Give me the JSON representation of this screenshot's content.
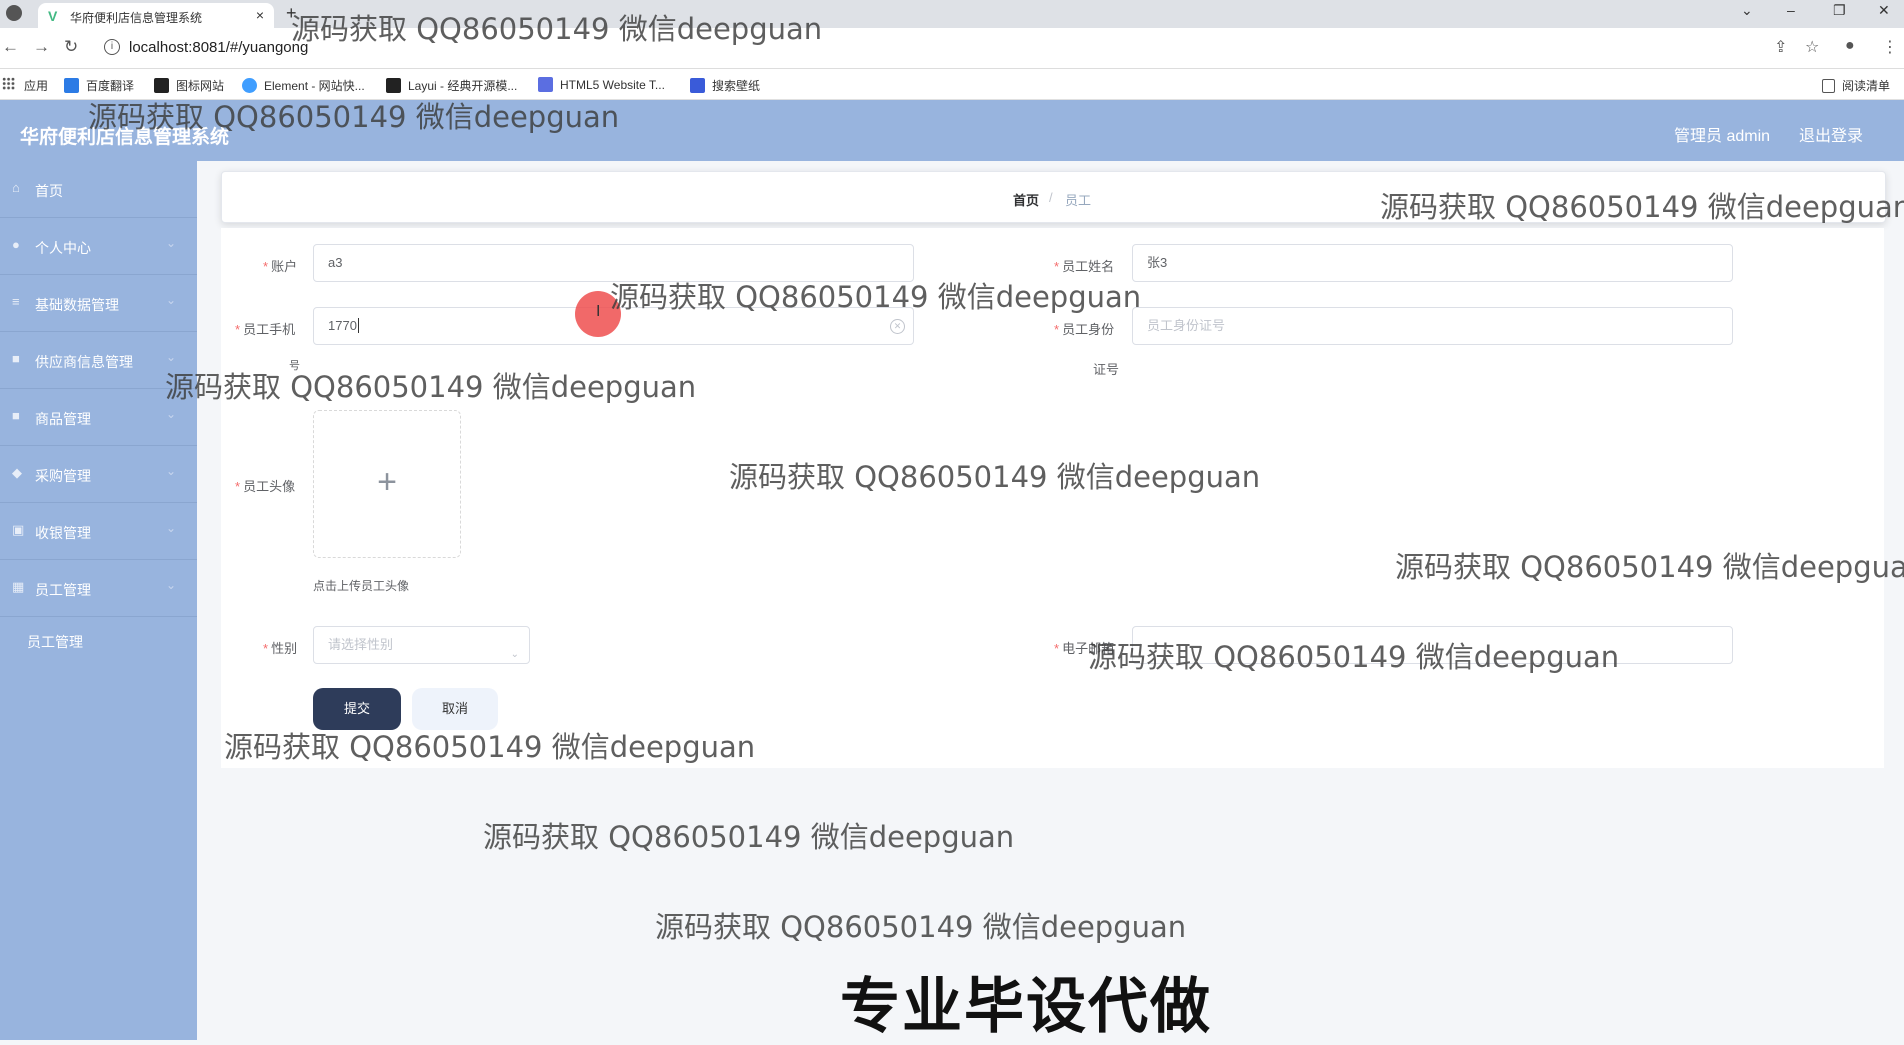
{
  "browser": {
    "tab_title": "华府便利店信息管理系统",
    "tab_close": "×",
    "new_tab": "+",
    "url": "localhost:8081/#/yuangong",
    "bookmarks": [
      {
        "label": "应用",
        "color": "#555555"
      },
      {
        "label": "百度翻译",
        "color": "#2c7be5"
      },
      {
        "label": "图标网站",
        "color": "#222222"
      },
      {
        "label": "Element - 网站快...",
        "color": "#409eff"
      },
      {
        "label": "Layui - 经典开源模...",
        "color": "#222222"
      },
      {
        "label": "HTML5 Website T...",
        "color": "#5b6ee1"
      },
      {
        "label": "搜索壁纸",
        "color": "#3a5bd9"
      }
    ],
    "reading_list": "阅读清单"
  },
  "header": {
    "title": "华府便利店信息管理系统",
    "admin": "管理员 admin",
    "logout": "退出登录"
  },
  "sidebar": {
    "items": [
      {
        "label": "首页",
        "icon": "home-icon",
        "glyph": "⌂"
      },
      {
        "label": "个人中心",
        "icon": "user-icon",
        "glyph": "●"
      },
      {
        "label": "基础数据管理",
        "icon": "list-icon",
        "glyph": "≡"
      },
      {
        "label": "供应商信息管理",
        "icon": "supplier-icon",
        "glyph": "■"
      },
      {
        "label": "商品管理",
        "icon": "goods-icon",
        "glyph": "■"
      },
      {
        "label": "采购管理",
        "icon": "purchase-icon",
        "glyph": "◆"
      },
      {
        "label": "收银管理",
        "icon": "cashier-icon",
        "glyph": "▣"
      },
      {
        "label": "员工管理",
        "icon": "staff-icon",
        "glyph": "▦"
      }
    ],
    "submenu": "员工管理"
  },
  "breadcrumb": {
    "home": "首页",
    "separator": "/",
    "current": "员工"
  },
  "form": {
    "account_label": "账户",
    "account_value": "a3",
    "name_label": "员工姓名",
    "name_value": "张3",
    "phone_label": "员工手机",
    "phone_value": "1770",
    "idcard_label_1": "员工身份",
    "idcard_label_2": "证号",
    "idcard_placeholder": "员工身份证号",
    "avatar_label": "员工头像",
    "upload_tip": "点击上传员工头像",
    "gender_label": "性别",
    "gender_placeholder": "请选择性别",
    "email_label": "电子邮箱",
    "submit": "提交",
    "cancel": "取消"
  },
  "overlay": {
    "watermark": "源码获取 QQ86050149 微信deepguan",
    "banner": "专业毕设代做"
  }
}
